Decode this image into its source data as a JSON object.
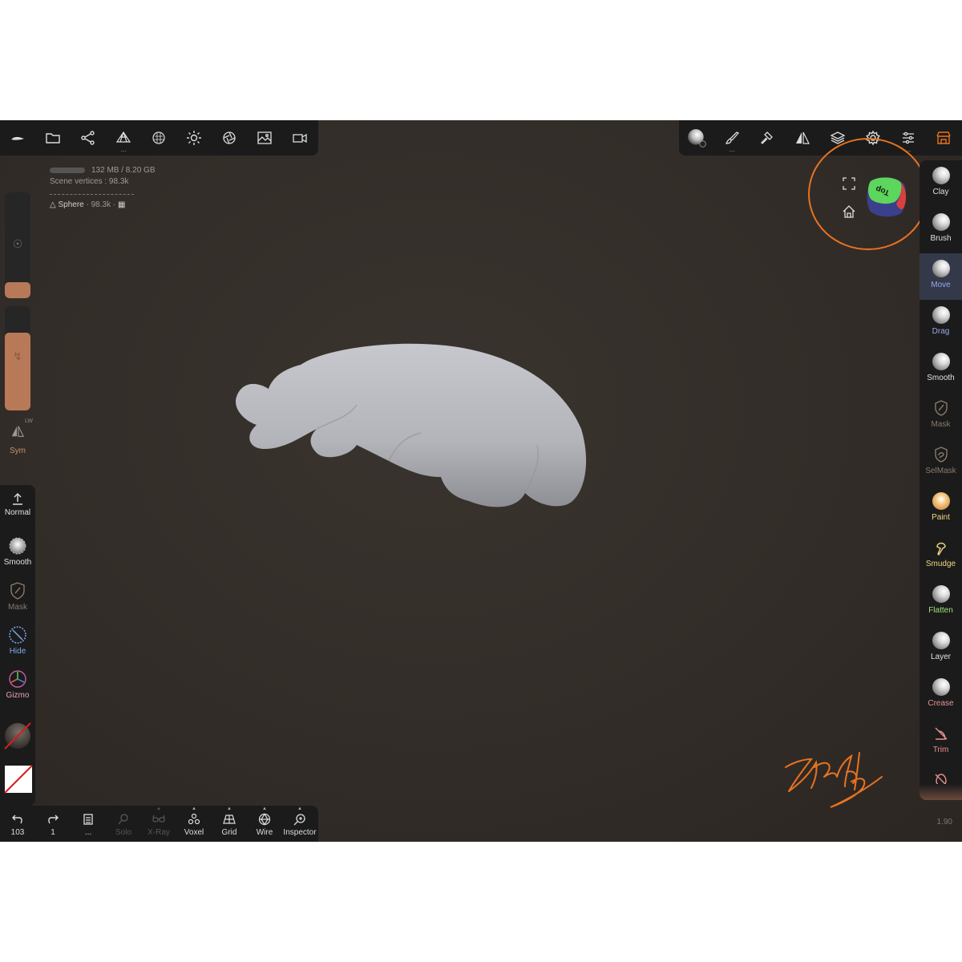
{
  "top_toolbar_left": [
    {
      "name": "logo"
    },
    {
      "name": "files"
    },
    {
      "name": "scene"
    },
    {
      "name": "topology",
      "dots": "..."
    },
    {
      "name": "material"
    },
    {
      "name": "lighting"
    },
    {
      "name": "post-process"
    },
    {
      "name": "background"
    },
    {
      "name": "camera"
    }
  ],
  "top_toolbar_right": {
    "brush_dots": "...",
    "settings_dots": "..."
  },
  "stats": {
    "memory": "132 MB / 8.20 GB",
    "scene_vertices": "Scene vertices : 98.3k",
    "object_name": "Sphere",
    "object_vertices": "· 98.3k ·"
  },
  "left_panel": {
    "radius_level": 0.15,
    "intensity_level": 0.75,
    "sym_label": "Sym",
    "sym_lw": "LW"
  },
  "left_tools": [
    {
      "label": "Normal",
      "color": "#e0e0e0"
    },
    {
      "label": "Smooth",
      "color": "#e0e0e0"
    },
    {
      "label": "Mask",
      "color": "#8a7a6a"
    },
    {
      "label": "Hide",
      "color": "#7fa8e8"
    },
    {
      "label": "Gizmo",
      "color": "#e8a0c0"
    }
  ],
  "bottom_bar": {
    "undo_count": "103",
    "redo_count": "1",
    "menu_dots": "...",
    "solo": "Solo",
    "xray": "X-Ray",
    "voxel": "Voxel",
    "grid": "Grid",
    "wire": "Wire",
    "inspector": "Inspector"
  },
  "right_tools": [
    {
      "label": "Clay",
      "color": "#e0e0e0",
      "active": false
    },
    {
      "label": "Brush",
      "color": "#e0e0e0",
      "active": false
    },
    {
      "label": "Move",
      "color": "#9aa6e8",
      "active": true
    },
    {
      "label": "Drag",
      "color": "#9aa6e8",
      "active": false
    },
    {
      "label": "Smooth",
      "color": "#e0e0e0",
      "active": false
    },
    {
      "label": "Mask",
      "color": "#8a7a6a",
      "active": false
    },
    {
      "label": "SelMask",
      "color": "#8a7a6a",
      "active": false
    },
    {
      "label": "Paint",
      "color": "#f0d880",
      "active": false
    },
    {
      "label": "Smudge",
      "color": "#f0d880",
      "active": false
    },
    {
      "label": "Flatten",
      "color": "#9fe07a",
      "active": false
    },
    {
      "label": "Layer",
      "color": "#e0e0e0",
      "active": false
    },
    {
      "label": "Crease",
      "color": "#e89090",
      "active": false
    },
    {
      "label": "Trim",
      "color": "#e89090",
      "active": false
    }
  ],
  "view_cube": {
    "face_label": "Top"
  },
  "version": "1.90",
  "colors": {
    "accent": "#e8731f",
    "slider": "#b87958",
    "bar": "#1b1b1b"
  }
}
